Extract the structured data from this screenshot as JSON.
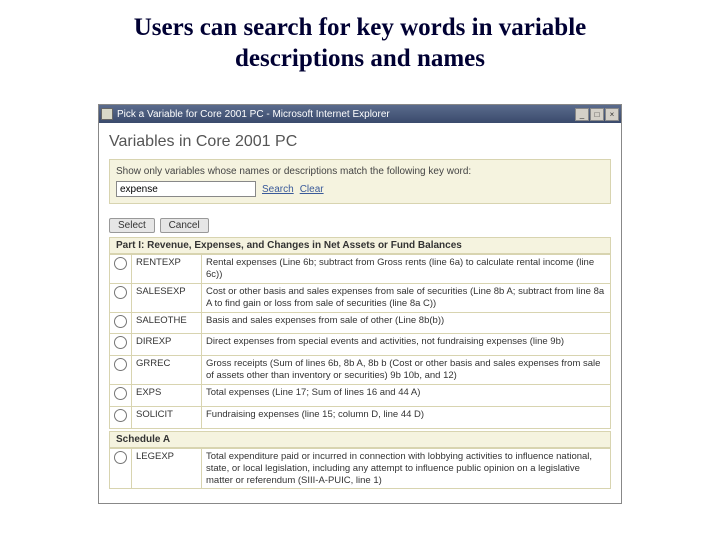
{
  "slide": {
    "title": "Users can search for key words in variable descriptions and names"
  },
  "titlebar": {
    "text": "Pick a Variable for Core 2001 PC - Microsoft Internet Explorer"
  },
  "sysbtn": {
    "min": "_",
    "max": "□",
    "close": "×"
  },
  "header": {
    "pageTitle": "Variables in Core 2001 PC"
  },
  "search": {
    "label": "Show only variables whose names or descriptions match the following key word:",
    "value": "expense",
    "searchLink": "Search",
    "clearLink": "Clear"
  },
  "buttons": {
    "select": "Select",
    "cancel": "Cancel"
  },
  "sections": [
    "Part I: Revenue, Expenses, and Changes in Net Assets or Fund Balances",
    "Schedule A"
  ],
  "rows1": [
    {
      "name": "RENTEXP",
      "desc": "Rental expenses (Line 6b; subtract from Gross rents (line 6a) to calculate rental income (line 6c))"
    },
    {
      "name": "SALESEXP",
      "desc": "Cost or other basis and sales expenses from sale of securities (Line 8b A; subtract from line 8a A to find gain or loss from sale of securities (line 8a C))"
    },
    {
      "name": "SALEOTHE",
      "desc": "Basis and sales expenses from sale of other (Line 8b(b))"
    },
    {
      "name": "DIREXP",
      "desc": "Direct expenses from special events and activities, not fundraising expenses (line 9b)"
    },
    {
      "name": "GRREC",
      "desc": "Gross receipts (Sum of lines 6b, 8b A, 8b b (Cost or other basis and sales expenses from sale of assets other than inventory or securities) 9b 10b, and 12)"
    },
    {
      "name": "EXPS",
      "desc": "Total expenses (Line 17; Sum of lines 16 and 44 A)"
    },
    {
      "name": "SOLICIT",
      "desc": "Fundraising expenses (line 15; column D, line 44 D)"
    }
  ],
  "rows2": [
    {
      "name": "LEGEXP",
      "desc": "Total expenditure paid or incurred in connection with lobbying activities to influence national, state, or local legislation, including any attempt to influence public opinion on a legislative matter or referendum (SIII-A-PUIC, line 1)"
    }
  ]
}
